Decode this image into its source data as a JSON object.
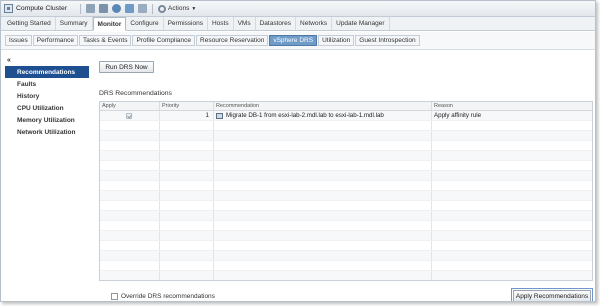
{
  "window": {
    "title": "Compute Cluster",
    "actions_label": "Actions"
  },
  "main_tabs": [
    {
      "label": "Getting Started"
    },
    {
      "label": "Summary"
    },
    {
      "label": "Monitor",
      "active": true
    },
    {
      "label": "Configure"
    },
    {
      "label": "Permissions"
    },
    {
      "label": "Hosts"
    },
    {
      "label": "VMs"
    },
    {
      "label": "Datastores"
    },
    {
      "label": "Networks"
    },
    {
      "label": "Update Manager"
    }
  ],
  "sub_tabs": [
    {
      "label": "Issues"
    },
    {
      "label": "Performance"
    },
    {
      "label": "Tasks & Events"
    },
    {
      "label": "Profile Compliance"
    },
    {
      "label": "Resource Reservation"
    },
    {
      "label": "vSphere DRS",
      "active": true
    },
    {
      "label": "Utilization"
    },
    {
      "label": "Guest Introspection"
    }
  ],
  "left_nav": {
    "collapse_glyph": "«",
    "items": [
      {
        "label": "Recommendations",
        "active": true
      },
      {
        "label": "Faults"
      },
      {
        "label": "History"
      },
      {
        "label": "CPU Utilization"
      },
      {
        "label": "Memory Utilization"
      },
      {
        "label": "Network Utilization"
      }
    ]
  },
  "content": {
    "run_button": "Run DRS Now",
    "section_title": "DRS Recommendations",
    "columns": [
      "Apply",
      "Priority",
      "Recommendation",
      "Reason"
    ],
    "rows": [
      {
        "apply_checked": true,
        "priority": "1",
        "recommendation": "Migrate DB-1 from esxi-lab-2.mdl.lab to esxi-lab-1.mdl.lab",
        "reason": "Apply affinity rule"
      }
    ],
    "override_label": "Override DRS recommendations",
    "apply_button": "Apply Recommendations"
  },
  "colors": {
    "active_nav": "#1d4f91",
    "active_subtab": "#6f9bc9"
  }
}
